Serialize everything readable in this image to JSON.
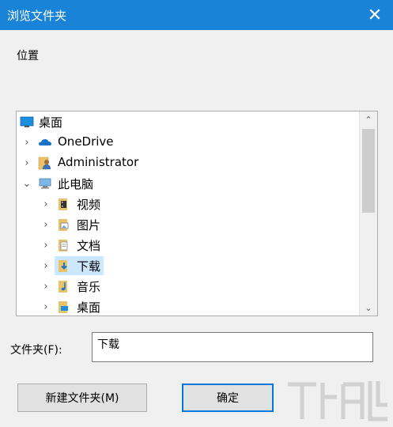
{
  "window": {
    "title": "浏览文件夹",
    "close_glyph": "✕"
  },
  "location_label": "位置",
  "tree": {
    "items": [
      {
        "label": "桌面",
        "icon": "desktop-icon",
        "expander": "",
        "level": 0
      },
      {
        "label": "OneDrive",
        "icon": "cloud-icon",
        "expander": "›",
        "level": 1
      },
      {
        "label": "Administrator",
        "icon": "user-folder-icon",
        "expander": "›",
        "level": 1
      },
      {
        "label": "此电脑",
        "icon": "computer-icon",
        "expander": "⌄",
        "level": 1
      },
      {
        "label": "视频",
        "icon": "video-folder-icon",
        "expander": "›",
        "level": 2
      },
      {
        "label": "图片",
        "icon": "pictures-folder-icon",
        "expander": "›",
        "level": 2
      },
      {
        "label": "文档",
        "icon": "documents-folder-icon",
        "expander": "›",
        "level": 2
      },
      {
        "label": "下载",
        "icon": "downloads-folder-icon",
        "expander": "›",
        "level": 2,
        "selected": true
      },
      {
        "label": "音乐",
        "icon": "music-folder-icon",
        "expander": "›",
        "level": 2
      },
      {
        "label": "桌面",
        "icon": "desktop-folder-icon",
        "expander": "›",
        "level": 2
      }
    ],
    "scroll_up": "⌃",
    "scroll_down": "⌄"
  },
  "folder_field": {
    "label": "文件夹(F):",
    "value": "下载"
  },
  "buttons": {
    "new_folder": "新建文件夹(M)",
    "ok": "确定"
  },
  "colors": {
    "titlebar": "#1883d7",
    "selection": "#cce8ff",
    "accent": "#0078d7"
  }
}
